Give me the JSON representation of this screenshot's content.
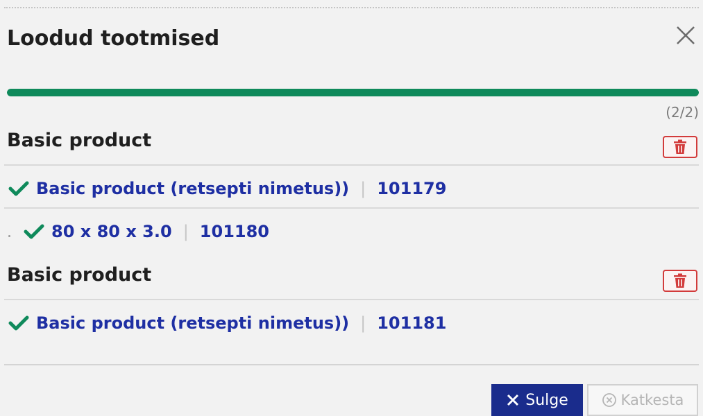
{
  "dialog": {
    "title": "Loodud tootmised",
    "progress": {
      "fraction": 1.0,
      "count_text": "(2/2)",
      "color": "#0f8a5b"
    }
  },
  "groups": [
    {
      "title": "Basic product",
      "items": [
        {
          "name": "Basic product (retsepti nimetus))",
          "id": "101179"
        },
        {
          "name": "80 x 80 x 3.0",
          "id": "101180"
        }
      ]
    },
    {
      "title": "Basic product",
      "items": [
        {
          "name": "Basic product (retsepti nimetus))",
          "id": "101181"
        }
      ]
    }
  ],
  "footer": {
    "close_label": "Sulge",
    "cancel_label": "Katkesta"
  },
  "colors": {
    "accent": "#1a2c8c",
    "link": "#1e2fa3",
    "success": "#0f8a5b",
    "danger": "#d23b3b"
  },
  "icons": [
    "close-icon",
    "trash-icon",
    "check-icon",
    "x-icon",
    "circle-x-icon"
  ]
}
